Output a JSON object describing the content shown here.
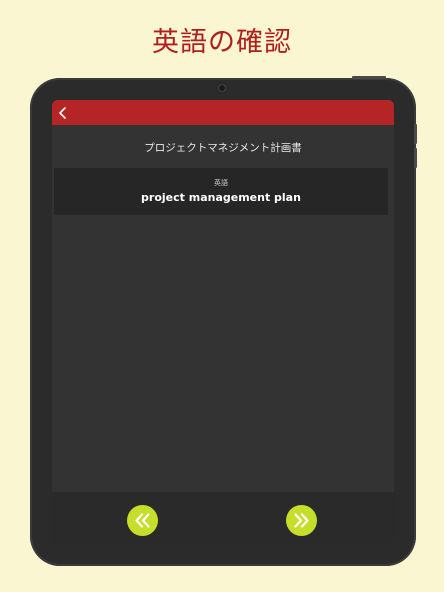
{
  "headline": "英語の確認",
  "term": {
    "japanese": "プロジェクトマネジメント計画書",
    "label": "英語",
    "english": "project management plan"
  },
  "icons": {
    "back": "chevron-left-icon",
    "prev": "double-chevron-left-icon",
    "next": "double-chevron-right-icon"
  },
  "colors": {
    "background": "#fbf6d2",
    "headline": "#b01e1e",
    "navbar": "#b52525",
    "screen": "#333333",
    "card": "#262626",
    "button": "#c5de2a"
  }
}
